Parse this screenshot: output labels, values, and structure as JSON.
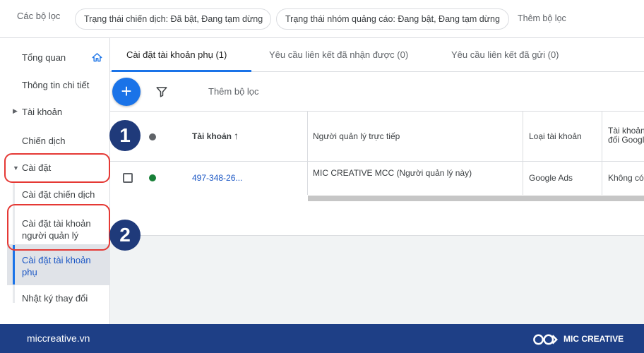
{
  "filter_bar": {
    "label": "Các bộ lọc",
    "chips": [
      "Trạng thái chiến dịch: Đã bật, Đang tạm dừng",
      "Trạng thái nhóm quảng cáo: Đang bật, Đang tạm dừng"
    ],
    "add_filter": "Thêm bộ lọc"
  },
  "sidebar": {
    "items": [
      {
        "label": "Tổng quan"
      },
      {
        "label": "Thông tin chi tiết"
      },
      {
        "label": "Tài khoản"
      },
      {
        "label": "Chiến dịch"
      },
      {
        "label": "Cài đặt"
      },
      {
        "label": "Cài đặt chiến dịch"
      },
      {
        "label": "Cài đặt tài khoản người quản lý"
      },
      {
        "label": "Cài đặt tài khoản phụ"
      },
      {
        "label": "Nhật ký thay đổi"
      }
    ]
  },
  "tabs": [
    {
      "label": "Cài đặt tài khoản phụ (1)"
    },
    {
      "label": "Yêu cầu liên kết đã nhận được (0)"
    },
    {
      "label": "Yêu cầu liên kết đã gửi (0)"
    }
  ],
  "toolbar": {
    "add_label": "+",
    "add_filter": "Thêm bộ lọc"
  },
  "table": {
    "columns": [
      "Tài khoản",
      "Người quản lý trực tiếp",
      "Loại tài khoản",
      "Tài khoản đối Googl"
    ],
    "sort_arrow": "↑",
    "rows": [
      {
        "account": "497-348-26...",
        "manager": "MIC CREATIVE MCC (Người quản lý này)",
        "type": "Google Ads",
        "extra": "Không có"
      }
    ]
  },
  "annotations": {
    "badge1": "1",
    "badge2": "2"
  },
  "footer": {
    "website": "miccreative.vn",
    "brand": "MIC CREATIVE"
  },
  "colors": {
    "accent": "#1a73e8",
    "highlight": "#e53935",
    "badge": "#1f3a7a",
    "footer": "#1e3f86",
    "status_enabled": "#188038"
  }
}
